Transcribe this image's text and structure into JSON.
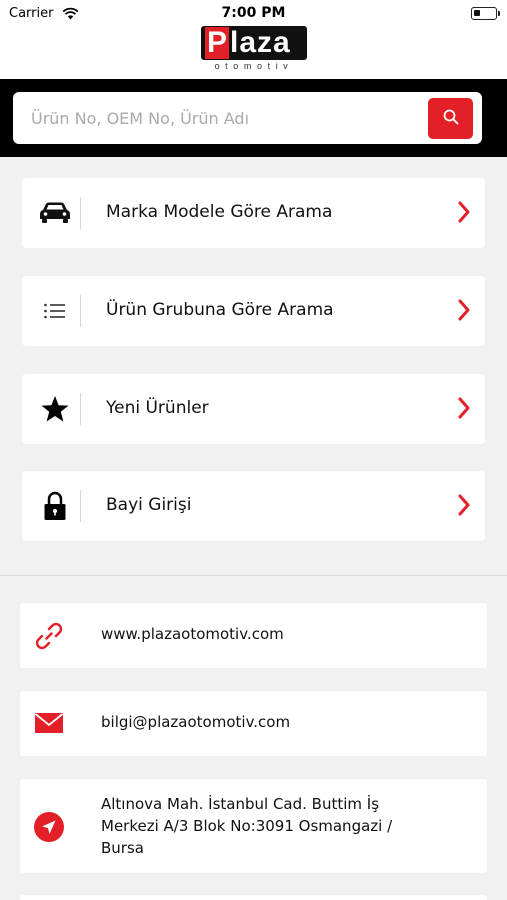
{
  "status_bar": {
    "carrier": "Carrier",
    "time": "7:00 PM"
  },
  "logo": {
    "initial": "P",
    "rest": "laza",
    "subtitle": "otomotiv"
  },
  "search": {
    "placeholder": "Ürün No, OEM No, Ürün Adı",
    "value": ""
  },
  "menu": {
    "items": [
      {
        "label": "Marka Modele Göre Arama",
        "icon": "car-icon"
      },
      {
        "label": "Ürün Grubuna Göre Arama",
        "icon": "list-icon"
      },
      {
        "label": "Yeni Ürünler",
        "icon": "star-icon"
      },
      {
        "label": "Bayi Girişi",
        "icon": "lock-icon"
      }
    ]
  },
  "contact": {
    "website": "www.plazaotomotiv.com",
    "email": "bilgi@plazaotomotiv.com",
    "address": "Altınova Mah. İstanbul Cad. Buttim İş Merkezi A/3 Blok No:3091 Osmangazi / Bursa"
  },
  "colors": {
    "accent": "#e32027",
    "header_band": "#000000",
    "background": "#f1f1f1"
  }
}
